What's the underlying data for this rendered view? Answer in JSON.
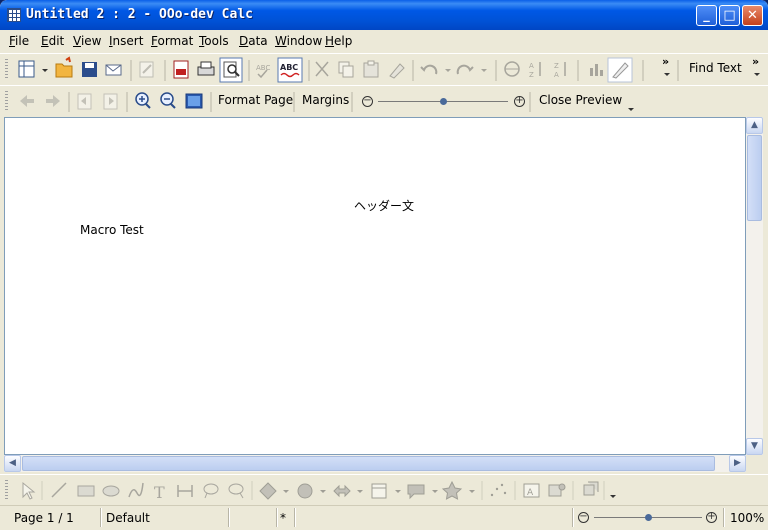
{
  "window": {
    "title": "Untitled 2 : 2 - OOo-dev Calc",
    "controls": {
      "minimize": "_",
      "maximize": "□",
      "close": "✕"
    }
  },
  "menu": [
    "File",
    "Edit",
    "View",
    "Insert",
    "Format",
    "Tools",
    "Data",
    "Window",
    "Help"
  ],
  "toolbar_standard": {
    "find_text": "Find Text",
    "overflow": "»"
  },
  "toolbar_preview": {
    "format_page": "Format Page",
    "margins": "Margins",
    "close_preview": "Close Preview",
    "zoom_level": 0.5
  },
  "document": {
    "header_text": "ヘッダー文",
    "cell_text": "Macro Test"
  },
  "status": {
    "page": "Page 1 / 1",
    "style": "Default",
    "modified": "*",
    "zoom": "100%",
    "zoom_level": 0.5
  },
  "icons": {
    "colors": {
      "accent": "#0058e6",
      "close": "#c4401c"
    }
  }
}
